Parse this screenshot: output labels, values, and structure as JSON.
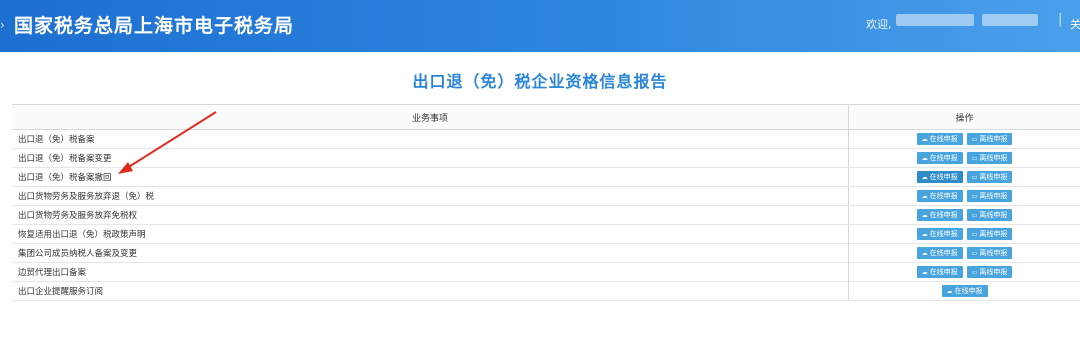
{
  "header": {
    "edge_mark": "›",
    "title": "国家税务总局上海市电子税务局",
    "welcome": "欢迎,",
    "separator": "|",
    "close_label": "关"
  },
  "report_title": "出口退（免）税企业资格信息报告",
  "table": {
    "col_item": "业务事项",
    "col_ops": "操作",
    "rows": [
      {
        "item": "出口退（免）税备案",
        "online": "在线申报",
        "offline": "离线申报"
      },
      {
        "item": "出口退（免）税备案变更",
        "online": "在线申报",
        "offline": "离线申报"
      },
      {
        "item": "出口退（免）税备案撤回",
        "online": "在线申报",
        "offline": "离线申报"
      },
      {
        "item": "出口货物劳务及服务放弃退（免）税",
        "online": "在线申报",
        "offline": "离线申报"
      },
      {
        "item": "出口货物劳务及服务放弃免税权",
        "online": "在线申报",
        "offline": "离线申报"
      },
      {
        "item": "恢复适用出口退（免）税政策声明",
        "online": "在线申报",
        "offline": "离线申报"
      },
      {
        "item": "集团公司成员纳税人备案及变更",
        "online": "在线申报",
        "offline": "离线申报"
      },
      {
        "item": "边贸代理出口备案",
        "online": "在线申报",
        "offline": "离线申报"
      },
      {
        "item": "出口企业提醒服务订阅",
        "online": "在线申报"
      }
    ]
  },
  "icons": {
    "online": "cloud-upload-icon",
    "offline": "monitor-icon"
  },
  "colors": {
    "header_blue": "#1d6fd0",
    "title_blue": "#2b86d8",
    "button_blue": "#48a4de",
    "annotation_red": "#e02b20"
  }
}
